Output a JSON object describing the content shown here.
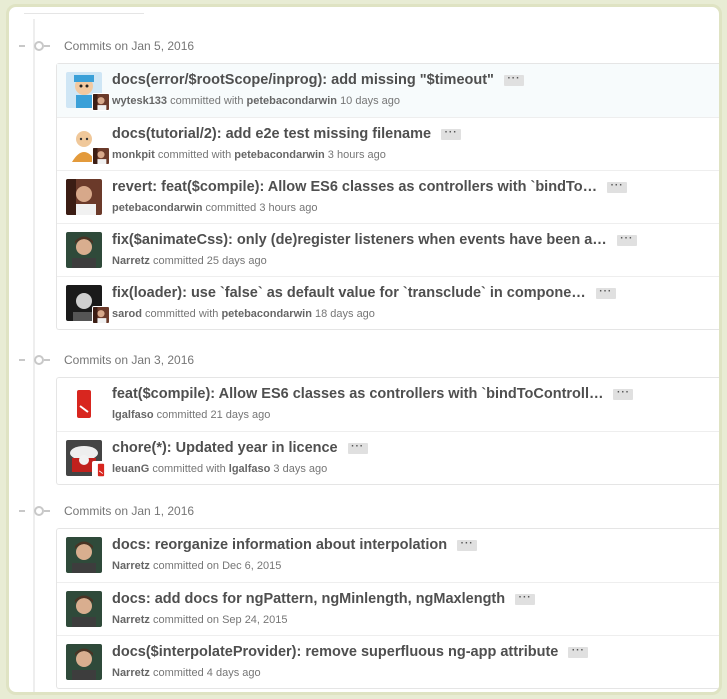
{
  "groups": [
    {
      "label": "Commits on Jan 5, 2016",
      "commits": [
        {
          "title": "docs(error/$rootScope/inprog): add missing \"$timeout\"",
          "author": "wytesk133",
          "verb": "committed with",
          "committer": "petebacondarwin",
          "time": "10 days ago",
          "avatar": "cartoon-avatar",
          "sub_avatar": "petebacondarwin-avatar"
        },
        {
          "title": "docs(tutorial/2): add e2e test missing filename",
          "author": "monkpit",
          "verb": "committed with",
          "committer": "petebacondarwin",
          "time": "3 hours ago",
          "avatar": "monk-avatar",
          "sub_avatar": "petebacondarwin-avatar"
        },
        {
          "title": "revert: feat($compile): Allow ES6 classes as controllers with `bindTo…",
          "author": "petebacondarwin",
          "verb": "committed",
          "committer": "",
          "time": "3 hours ago",
          "avatar": "petebacondarwin-avatar",
          "sub_avatar": ""
        },
        {
          "title": "fix($animateCss): only (de)register listeners when events have been a…",
          "author": "Narretz",
          "verb": "committed",
          "committer": "",
          "time": "25 days ago",
          "avatar": "narretz-avatar",
          "sub_avatar": ""
        },
        {
          "title": "fix(loader): use `false` as default value for `transclude` in compone…",
          "author": "sarod",
          "verb": "committed with",
          "committer": "petebacondarwin",
          "time": "18 days ago",
          "avatar": "sarod-avatar",
          "sub_avatar": "petebacondarwin-avatar"
        }
      ]
    },
    {
      "label": "Commits on Jan 3, 2016",
      "commits": [
        {
          "title": "feat($compile): Allow ES6 classes as controllers with `bindToControll…",
          "author": "lgalfaso",
          "verb": "committed",
          "committer": "",
          "time": "21 days ago",
          "avatar": "lgalfaso-avatar",
          "sub_avatar": ""
        },
        {
          "title": "chore(*): Updated year in licence",
          "author": "leuanG",
          "verb": "committed with",
          "committer": "lgalfaso",
          "time": "3 days ago",
          "avatar": "leuang-avatar",
          "sub_avatar": "lgalfaso-avatar"
        }
      ]
    },
    {
      "label": "Commits on Jan 1, 2016",
      "commits": [
        {
          "title": "docs: reorganize information about interpolation",
          "author": "Narretz",
          "verb": "committed on",
          "committer": "",
          "time": "Dec 6, 2015",
          "avatar": "narretz-avatar",
          "sub_avatar": ""
        },
        {
          "title": "docs: add docs for ngPattern, ngMinlength, ngMaxlength",
          "author": "Narretz",
          "verb": "committed on",
          "committer": "",
          "time": "Sep 24, 2015",
          "avatar": "narretz-avatar",
          "sub_avatar": ""
        },
        {
          "title": "docs($interpolateProvider): remove superfluous ng-app attribute",
          "author": "Narretz",
          "verb": "committed",
          "committer": "",
          "time": "4 days ago",
          "avatar": "narretz-avatar",
          "sub_avatar": ""
        }
      ]
    }
  ],
  "ellipsis_label": "···",
  "colors": {
    "highlight_row": "#f7fbfc",
    "title_text": "#4f4f4f",
    "meta_text": "#767676",
    "frame": "#dfe3c3"
  }
}
